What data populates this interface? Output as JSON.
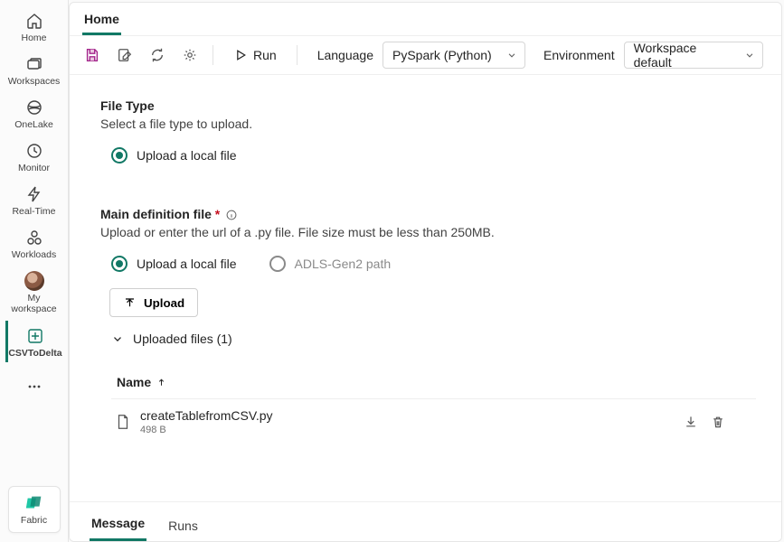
{
  "rail": {
    "items": [
      {
        "label": "Home"
      },
      {
        "label": "Workspaces"
      },
      {
        "label": "OneLake"
      },
      {
        "label": "Monitor"
      },
      {
        "label": "Real-Time"
      },
      {
        "label": "Workloads"
      },
      {
        "label": "My workspace"
      },
      {
        "label": "CSVToDelta"
      }
    ],
    "bottom": {
      "label": "Fabric"
    }
  },
  "breadcrumb": {
    "title": "Home"
  },
  "toolbar": {
    "run_label": "Run",
    "language_label": "Language",
    "language_value": "PySpark (Python)",
    "environment_label": "Environment",
    "environment_value": "Workspace default"
  },
  "fileType": {
    "title": "File Type",
    "subtitle": "Select a file type to upload.",
    "option_local": "Upload a local file"
  },
  "mainDef": {
    "title": "Main definition file",
    "subtitle": "Upload or enter the url of a .py file. File size must be less than 250MB.",
    "option_local": "Upload a local file",
    "option_adls": "ADLS-Gen2 path",
    "upload_button": "Upload",
    "uploaded_header": "Uploaded files (1)",
    "name_header": "Name",
    "files": [
      {
        "name": "createTablefromCSV.py",
        "size": "498 B"
      }
    ]
  },
  "bottomTabs": {
    "message": "Message",
    "runs": "Runs"
  }
}
